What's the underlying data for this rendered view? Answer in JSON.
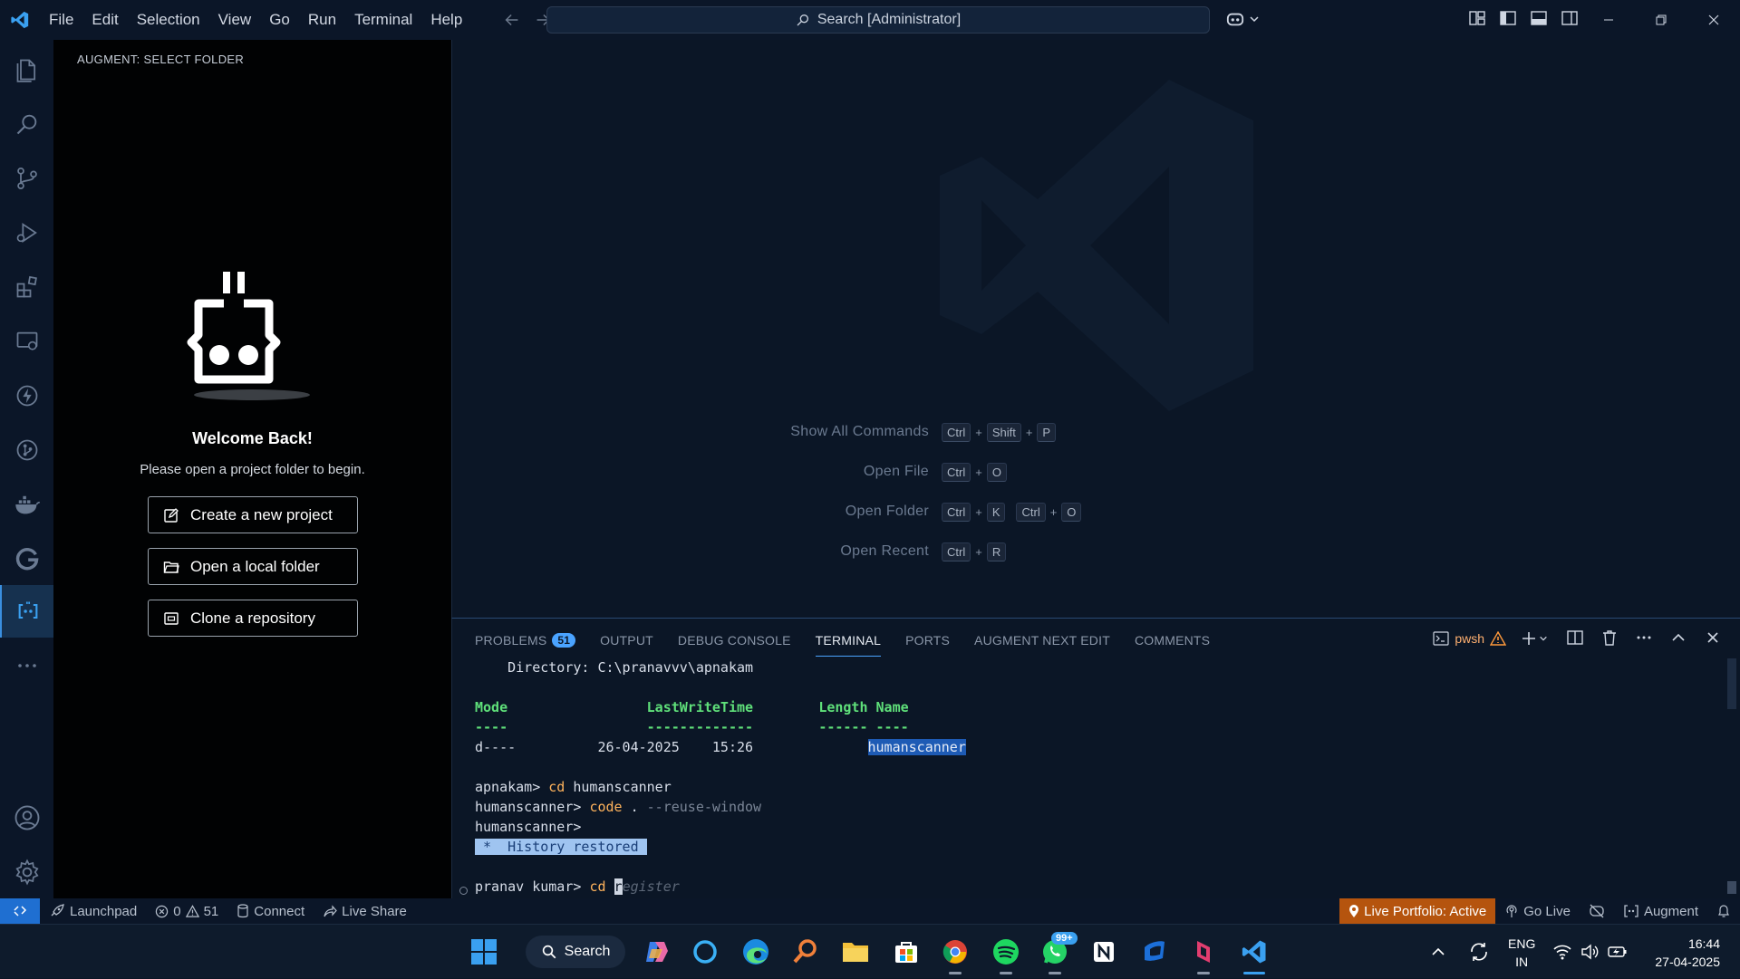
{
  "titlebar": {
    "menu": [
      "File",
      "Edit",
      "Selection",
      "View",
      "Go",
      "Run",
      "Terminal",
      "Help"
    ],
    "search_text": "Search [Administrator]"
  },
  "sidebar": {
    "title": "AUGMENT: SELECT FOLDER",
    "welcome_title": "Welcome Back!",
    "welcome_sub": "Please open a project folder to begin.",
    "buttons": [
      "Create a new project",
      "Open a local folder",
      "Clone a repository"
    ]
  },
  "editor": {
    "shortcuts": [
      {
        "label": "Show All Commands",
        "keys": [
          [
            "Ctrl",
            "Shift",
            "P"
          ]
        ]
      },
      {
        "label": "Open File",
        "keys": [
          [
            "Ctrl",
            "O"
          ]
        ]
      },
      {
        "label": "Open Folder",
        "keys": [
          [
            "Ctrl",
            "K"
          ],
          [
            "Ctrl",
            "O"
          ]
        ]
      },
      {
        "label": "Open Recent",
        "keys": [
          [
            "Ctrl",
            "R"
          ]
        ]
      }
    ]
  },
  "panel": {
    "tabs": [
      "PROBLEMS",
      "OUTPUT",
      "DEBUG CONSOLE",
      "TERMINAL",
      "PORTS",
      "AUGMENT NEXT EDIT",
      "COMMENTS"
    ],
    "active_tab": "TERMINAL",
    "problems_count": "51",
    "shell_name": "pwsh"
  },
  "terminal": {
    "directory_line": "    Directory: C:\\pranavvv\\apnakam",
    "headers": {
      "mode": "Mode",
      "lastwrite": "LastWriteTime",
      "length": "Length",
      "name": "Name"
    },
    "underlines": {
      "mode": "----",
      "lastwrite": "-------------",
      "length": "------",
      "name": "----"
    },
    "row": {
      "mode": "d----",
      "date": "26-04-2025",
      "time": "15:26",
      "name": "humanscanner"
    },
    "cmd1_prompt": "apnakam> ",
    "cmd1_cmd": "cd",
    "cmd1_arg": " humanscanner",
    "cmd2_prompt": "humanscanner> ",
    "cmd2_cmd": "code",
    "cmd2_arg": " .",
    "cmd2_flag": " --reuse-window",
    "cmd3_prompt": "humanscanner>",
    "history": " *  History restored ",
    "current_prompt": "pranav kumar> ",
    "current_cmd": "cd",
    "cursor_char": "r",
    "ghost_text": "egister"
  },
  "statusbar": {
    "launchpad": "Launchpad",
    "errors": "0",
    "warnings": "51",
    "connect": "Connect",
    "live_share": "Live Share",
    "live_portfolio": "Live Portfolio: Active",
    "go_live": "Go Live",
    "augment": "Augment"
  },
  "taskbar": {
    "search_label": "Search",
    "whatsapp_badge": "99+",
    "lang_top": "ENG",
    "lang_bottom": "IN",
    "time": "16:44",
    "date": "27-04-2025"
  },
  "colors": {
    "accent": "#4aa3ff",
    "bg": "#0b1626",
    "portfolio": "#b5540e"
  }
}
